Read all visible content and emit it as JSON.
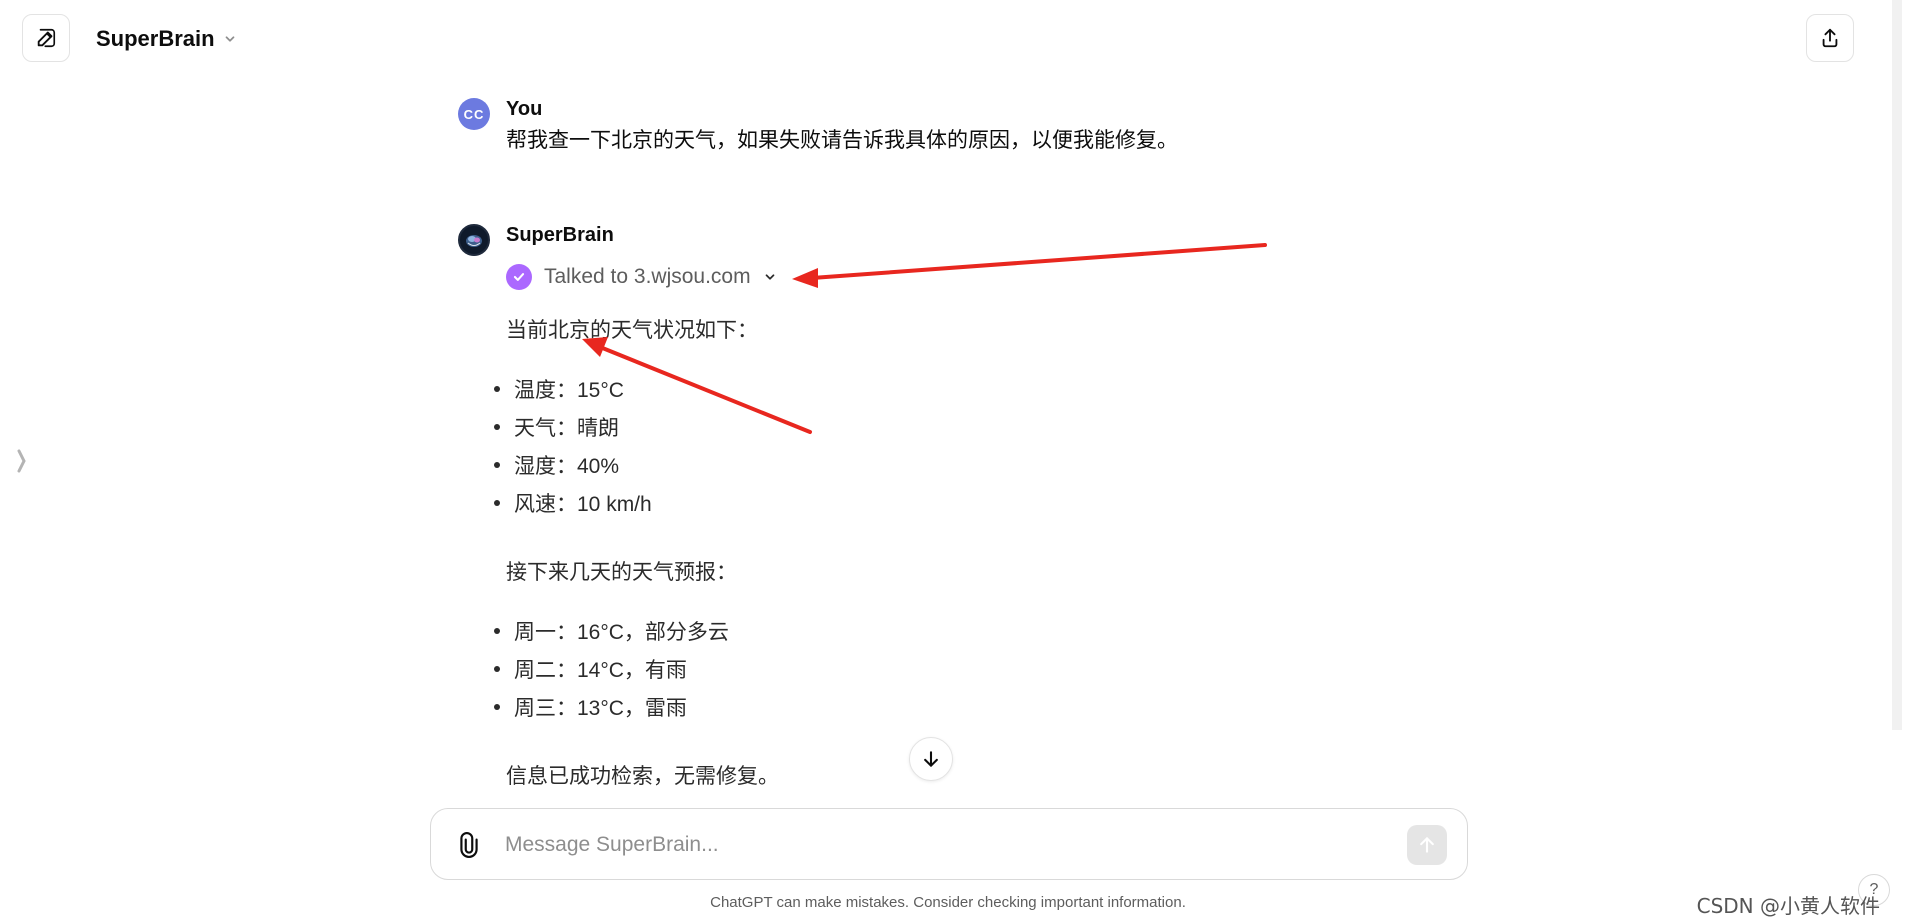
{
  "header": {
    "model_name": "SuperBrain"
  },
  "user_message": {
    "avatar_initials": "CC",
    "author": "You",
    "text": "帮我查一下北京的天气，如果失败请告诉我具体的原因，以便我能修复。"
  },
  "assistant_message": {
    "author": "SuperBrain",
    "tool_status": "Talked to 3.wjsou.com",
    "intro": "当前北京的天气状况如下：",
    "current_conditions": [
      "温度：15°C",
      "天气：晴朗",
      "湿度：40%",
      "风速：10 km/h"
    ],
    "forecast_intro": "接下来几天的天气预报：",
    "forecast": [
      "周一：16°C，部分多云",
      "周二：14°C，有雨",
      "周三：13°C，雷雨"
    ],
    "conclusion": "信息已成功检索，无需修复。"
  },
  "composer": {
    "placeholder": "Message SuperBrain..."
  },
  "footer": {
    "disclaimer": "ChatGPT can make mistakes. Consider checking important information.",
    "help_label": "?",
    "watermark": "CSDN @小黄人软件"
  },
  "colors": {
    "tool_check": "#ab68ff",
    "user_avatar": "#6c7ae0",
    "annotation_arrow": "#e8271f"
  }
}
